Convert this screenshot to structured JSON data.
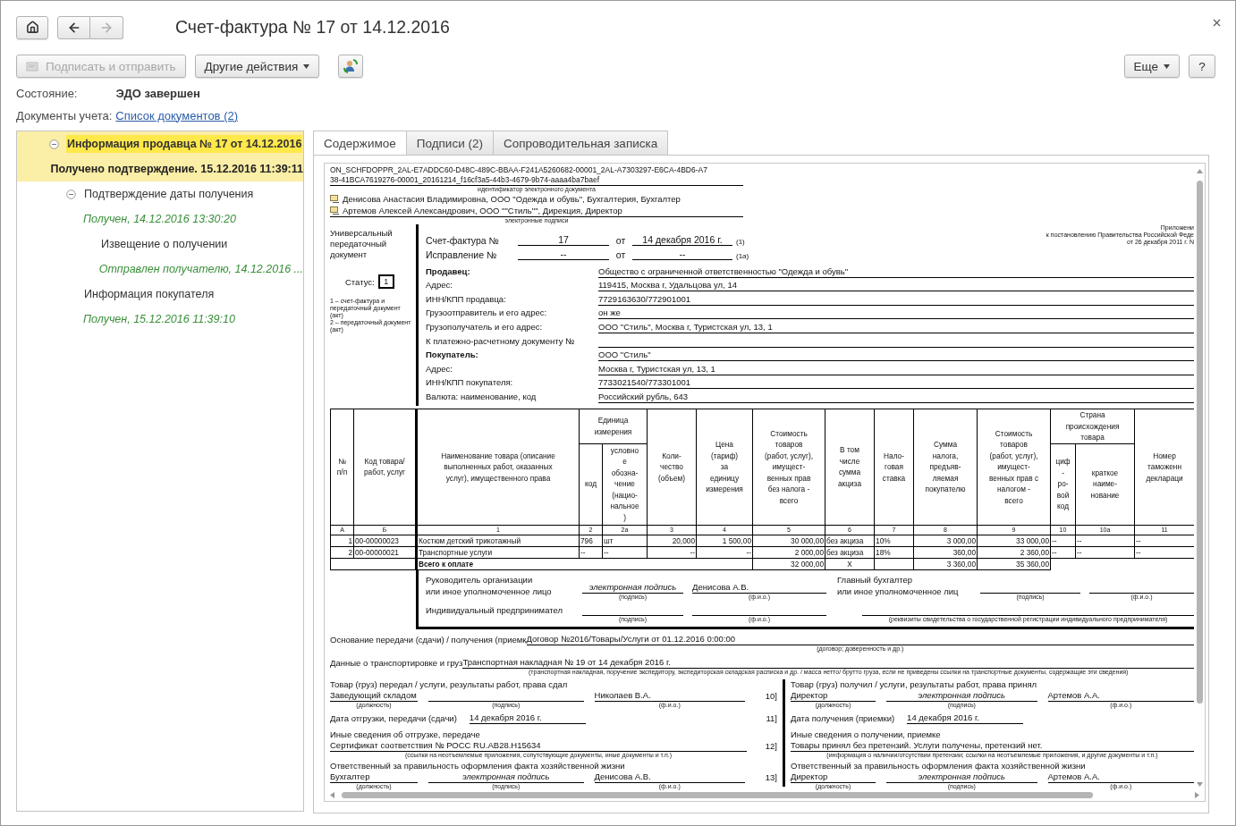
{
  "nav": {
    "back": {
      "disabled": false
    },
    "forward": {
      "disabled": true
    }
  },
  "window": {
    "title": "Счет-фактура № 17 от 14.12.2016"
  },
  "toolbar": {
    "buttons": [
      {
        "kind": "sign",
        "label": "Подписать и отправить",
        "disabled": true
      },
      {
        "kind": "menu",
        "label": "Другие действия",
        "disabled": false
      },
      {
        "kind": "icon",
        "disabled": false
      }
    ],
    "right_buttons": [
      {
        "kind": "menu",
        "label": "Еще"
      },
      {
        "kind": "text",
        "label": "?"
      }
    ]
  },
  "state": {
    "label": "Состояние:",
    "value": "ЭДО завершен"
  },
  "documents": {
    "label": "Документы учета:",
    "link": "Список документов (2)"
  },
  "tree": [
    {
      "title": "Информация продавца № 17 от 14.12.2016",
      "status": "Получено подтверждение. 15.12.2016 11:39:11",
      "selected": true,
      "expanded": true,
      "children": [
        {
          "title": "Подтверждение даты получения",
          "status": "Получен, 14.12.2016 13:30:20",
          "selected": false,
          "expanded": true,
          "children": [
            {
              "title": "Извещение о получении",
              "status": "Отправлен получателю, 14.12.2016 ...",
              "selected": false
            }
          ]
        },
        {
          "title": "Информация покупателя",
          "status": "Получен, 15.12.2016 11:39:10",
          "selected": false
        }
      ]
    }
  ],
  "tabs": [
    {
      "label": "Содержимое",
      "selected": true
    },
    {
      "label": "Подписи (2)",
      "selected": false
    },
    {
      "label": "Сопроводительная записка",
      "selected": false
    }
  ],
  "document": {
    "identifier": {
      "lines": [
        "ON_SCHFDOPPR_2AL-E7ADDC60-D48C-489C-BBAA-F241A5260682-00001_2AL-A7303297-E6CA-4BD6-A7",
        "38-41BCA7619276-00001_20161214_f16cf3a5-44b3-4679-9b74-aaaa4ba7baef"
      ],
      "caption": "идентификатор электронного документа"
    },
    "signatures": {
      "items": [
        "Денисова Анастасия Владимировна, ООО \"Одежда и обувь\", Бухгалтерия, Бухгалтер",
        "Артемов Алексей Александрович, ООО \"\"Стиль\"\", Дирекция, Директор"
      ],
      "caption": "электронные подписи"
    },
    "doc_type": "Универсальный передаточный документ",
    "status": {
      "label": "Статус:",
      "value": "1"
    },
    "status_notes": [
      "1 – счет-фактура и передаточный документ (акт)",
      "2 – передаточный документ (акт)"
    ],
    "appendix": [
      "Приложени",
      "к постановлению Правительства Российской Феде",
      "от 26 декабря 2011 г. N"
    ],
    "invoice_rows": [
      {
        "label": "Счет-фактура №",
        "number": "17",
        "from": "от",
        "date": "14 декабря 2016 г.",
        "ref": "(1)"
      },
      {
        "label": "Исправление №",
        "number": "--",
        "from": "от",
        "date": "--",
        "ref": "(1а)"
      }
    ],
    "fields": [
      {
        "kind": "party",
        "label": "Продавец:",
        "value": "Общество с ограниченной ответственностью \"Одежда и обувь\""
      },
      {
        "kind": "field",
        "label": "Адрес:",
        "value": "119415, Москва г, Удальцова ул, 14"
      },
      {
        "kind": "field",
        "label": "ИНН/КПП продавца:",
        "value": "7729163630/772901001"
      },
      {
        "kind": "field",
        "label": "Грузоотправитель и его адрес:",
        "value": "он же"
      },
      {
        "kind": "field",
        "label": "Грузополучатель и его адрес:",
        "value": "ООО \"Стиль\", Москва г, Туристская ул, 13, 1"
      },
      {
        "kind": "field",
        "label": "К платежно-расчетному документу №"
      },
      {
        "kind": "party",
        "label": "Покупатель:",
        "value": "ООО \"Стиль\""
      },
      {
        "kind": "field",
        "label": "Адрес:",
        "value": "Москва г, Туристская ул, 13, 1"
      },
      {
        "kind": "field",
        "label": "ИНН/КПП покупателя:",
        "value": "7733021540/773301001"
      },
      {
        "kind": "field",
        "label": "Валюта: наименование, код",
        "value": "Российский рубль, 643"
      }
    ],
    "table": {
      "header": [
        [
          {
            "text": "№\nп/п",
            "rowspan": 2
          },
          {
            "text": "Код товара/\nработ, услуг",
            "rowspan": 2
          },
          {
            "text": "Наименование товара (описание\nвыполненных работ, оказанных\nуслуг), имущественного права",
            "rowspan": 2
          },
          {
            "text": "Единица\nизмерения",
            "colspan": 2
          },
          {
            "text": "Коли-\nчество\n(объем)",
            "rowspan": 2
          },
          {
            "text": "Цена\n(тариф)\nза\nединицу\nизмерения",
            "rowspan": 2
          },
          {
            "text": "Стоимость\nтоваров\n(работ, услуг),\nимущест-\nвенных прав\nбез налога -\nвсего",
            "rowspan": 2
          },
          {
            "text": "В том\nчисле\nсумма\nакциза",
            "rowspan": 2
          },
          {
            "text": "Нало-\nговая\nставка",
            "rowspan": 2
          },
          {
            "text": "Сумма\nналога,\nпредъяв-\nляемая\nпокупателю",
            "rowspan": 2
          },
          {
            "text": "Стоимость\nтоваров\n(работ, услуг),\nимущест-\nвенных прав с\nналогом -\nвсего",
            "rowspan": 2
          },
          {
            "text": "Страна\nпроисхождения\nтовара",
            "colspan": 2
          },
          {
            "text": "Номер\nтаможенн\nдеклараци",
            "rowspan": 2
          }
        ],
        [
          {
            "text": "код"
          },
          {
            "text": "условно\nе\nобозна-\nчение\n(нацио-\nнальное\n)"
          },
          {
            "text": "циф\n-\nро-\nвой\nкод"
          },
          {
            "text": "краткое\nнаиме-\nнование"
          }
        ]
      ],
      "columns": [
        {
          "number": "А",
          "kind": "number"
        },
        {
          "number": "Б",
          "kind": "text"
        },
        {
          "number": "1",
          "kind": "text"
        },
        {
          "number": "2",
          "kind": "text"
        },
        {
          "number": "2а",
          "kind": "text"
        },
        {
          "number": "3",
          "kind": "number"
        },
        {
          "number": "4",
          "kind": "number"
        },
        {
          "number": "5",
          "kind": "number"
        },
        {
          "number": "6",
          "kind": "text"
        },
        {
          "number": "7",
          "kind": "text"
        },
        {
          "number": "8",
          "kind": "number"
        },
        {
          "number": "9",
          "kind": "number"
        },
        {
          "number": "10",
          "kind": "text"
        },
        {
          "number": "10а",
          "kind": "text"
        },
        {
          "number": "11",
          "kind": "text"
        }
      ],
      "rows": [
        [
          "1",
          "00-00000023",
          "Костюм детский трикотажный",
          "796",
          "шт",
          "20,000",
          "1 500,00",
          "30 000,00",
          "без акциза",
          "10%",
          "3 000,00",
          "33 000,00",
          "--",
          "--",
          "--"
        ],
        [
          "2",
          "00-00000021",
          "Транспортные услуги",
          "--",
          "--",
          "--",
          "--",
          "2 000,00",
          "без акциза",
          "18%",
          "360,00",
          "2 360,00",
          "--",
          "--",
          "--"
        ]
      ],
      "total": {
        "label": "Всего к оплате",
        "cost": "32 000,00",
        "excise": "Х",
        "tax": "3 360,00",
        "total": "35 360,00"
      }
    },
    "signers": {
      "head": {
        "label": "Руководитель организации\nили иное уполномоченное лицо",
        "signature": "электронная подпись",
        "signature_caption": "(подпись)",
        "name": "Денисова А.В.",
        "name_caption": "(ф.и.о.)"
      },
      "accountant": {
        "label": "Главный бухгалтер\nили иное уполномоченное лиц",
        "signature_caption": "(подпись)",
        "name_caption": "(ф.и.о.)"
      },
      "entrepreneur": {
        "label": "Индивидуальный предпринимател",
        "signature_caption": "(подпись)",
        "name_caption": "(ф.и.о.)",
        "registration_caption": "(реквизиты свидетельства о государственной  регистрации индивидуального предпринимателя)"
      }
    },
    "basis": {
      "label": "Основание передачи (сдачи) / получения (приемк",
      "value": "Договор №2016/Товары/Услуги от 01.12.2016 0:00:00",
      "caption": "(договор; доверенность и др.)"
    },
    "transport": {
      "label": "Данные о транспортировке и груз",
      "value": "Транспортная накладная № 19 от 14 декабря 2016 г.",
      "caption": "(транспортная накладная, поручение экспедитору, экспедиторская складская расписка и др. / масса нетто/ брутто груза, если не приведены ссылки на транспортные документы, содержащие эти сведения)"
    },
    "handover": [
      {
        "heading": "Товар (груз) передал / услуги, результаты работ, права сдал",
        "signer": {
          "position": "Заведующий складом",
          "position_caption": "(должность)",
          "signature_caption": "(подпись)",
          "name": "Николаев В.А.",
          "name_caption": "(ф.и.о.)",
          "number": "10]"
        },
        "date": {
          "label": "Дата отгрузки, передачи (сдачи)",
          "value": "14 декабря 2016 г.",
          "number": "11]"
        },
        "other_heading": "Иные сведения об отгрузке, передаче",
        "other": {
          "value": "Сертификат соответствия № РОСС RU.AB28.H15634",
          "number": "12]",
          "caption": "(ссылки на неотъемлемые приложения, сопутствующие документы, иные документы и т.п.)"
        },
        "responsible_heading": "Ответственный за правильность оформления факта хозяйственной жизни",
        "responsible": {
          "position": "Бухгалтер",
          "position_caption": "(должность)",
          "signature": "электронная подпись",
          "signature_caption": "(подпись)",
          "name": "Денисова А.В.",
          "name_caption": "(ф.и.о.)",
          "number": "13]"
        }
      },
      {
        "heading": "Товар (груз) получил / услуги, результаты работ, права принял",
        "signer": {
          "position": "Директор",
          "position_caption": "(должность)",
          "signature": "электронная подпись",
          "signature_caption": "(подпись)",
          "name": "Артемов А.А.",
          "name_caption": "(ф.и.о.)"
        },
        "date": {
          "label": "Дата получения (приемки)",
          "value": "14 декабря 2016 г."
        },
        "other_heading": "Иные сведения о получении, приемке",
        "other": {
          "value": "Товары принял без претензий. Услуги получены, претензий нет.",
          "caption": "(информация о наличии/отсутствии претензии; ссылки на неотъемлемые приложения, и другие  документы и т.п.)"
        },
        "responsible_heading": "Ответственный за правильность оформления факта хозяйственной жизни",
        "responsible": {
          "position": "Директор",
          "position_caption": "(должность)",
          "signature": "электронная подпись",
          "signature_caption": "(подпись)",
          "name": "Артемов А.А.",
          "name_caption": "(ф.и.о.)"
        }
      }
    ]
  }
}
